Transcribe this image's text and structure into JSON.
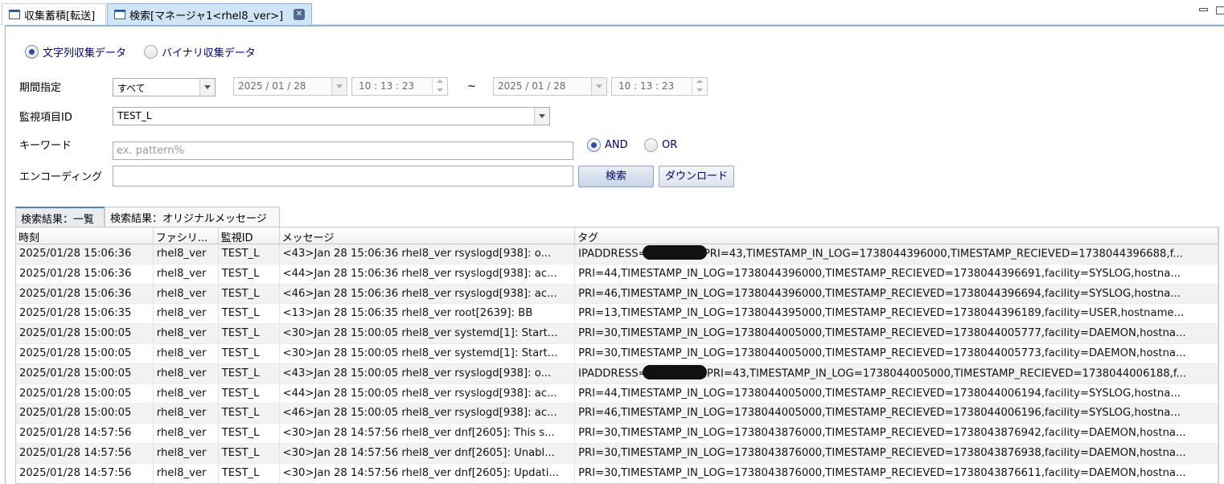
{
  "tabs": [
    {
      "label": "収集蓄積[転送]",
      "active": false
    },
    {
      "label": "検索[マネージャ1<rhel8_ver>]",
      "active": true,
      "close": "✕"
    }
  ],
  "form": {
    "data_type": {
      "string_label": "文字列収集データ",
      "binary_label": "バイナリ収集データ",
      "selected": "string"
    },
    "period": {
      "label": "期間指定",
      "mode": "すべて",
      "from_date": "2025 / 01 / 28",
      "from_time": "10 : 13 : 23",
      "separator": "~",
      "to_date": "2025 / 01 / 28",
      "to_time": "10 : 13 : 23"
    },
    "monitor_id": {
      "label": "監視項目ID",
      "value": "TEST_L"
    },
    "keyword": {
      "label": "キーワード",
      "placeholder": "ex. pattern%",
      "value": ""
    },
    "operator": {
      "and_label": "AND",
      "or_label": "OR",
      "selected": "AND"
    },
    "encoding": {
      "label": "エンコーディング",
      "value": ""
    },
    "search_button": "検索",
    "download_button": "ダウンロード"
  },
  "result_tabs": [
    "検索結果：一覧",
    "検索結果：オリジナルメッセージ"
  ],
  "table": {
    "columns": [
      "時刻",
      "ファシリ...",
      "監視ID",
      "メッセージ",
      "タグ"
    ],
    "rows": [
      {
        "time": "2025/01/28 15:06:36",
        "facility": "rhel8_ver",
        "monitor": "TEST_L",
        "message": "<43>Jan 28 15:06:36 rhel8_ver rsyslogd[938]: o...",
        "tag_prefix": "IPADDRESS=",
        "redacted": true,
        "tag": "PRI=43,TIMESTAMP_IN_LOG=1738044396000,TIMESTAMP_RECIEVED=1738044396688,f..."
      },
      {
        "time": "2025/01/28 15:06:36",
        "facility": "rhel8_ver",
        "monitor": "TEST_L",
        "message": "<44>Jan 28 15:06:36 rhel8_ver rsyslogd[938]: ac...",
        "tag_prefix": "",
        "redacted": false,
        "tag": "PRI=44,TIMESTAMP_IN_LOG=1738044396000,TIMESTAMP_RECIEVED=1738044396691,facility=SYSLOG,hostna..."
      },
      {
        "time": "2025/01/28 15:06:36",
        "facility": "rhel8_ver",
        "monitor": "TEST_L",
        "message": "<46>Jan 28 15:06:36 rhel8_ver rsyslogd[938]: ac...",
        "tag_prefix": "",
        "redacted": false,
        "tag": "PRI=46,TIMESTAMP_IN_LOG=1738044396000,TIMESTAMP_RECIEVED=1738044396694,facility=SYSLOG,hostna..."
      },
      {
        "time": "2025/01/28 15:06:35",
        "facility": "rhel8_ver",
        "monitor": "TEST_L",
        "message": "<13>Jan 28 15:06:35 rhel8_ver root[2639]: BB",
        "tag_prefix": "",
        "redacted": false,
        "tag": "PRI=13,TIMESTAMP_IN_LOG=1738044395000,TIMESTAMP_RECIEVED=1738044396189,facility=USER,hostname..."
      },
      {
        "time": "2025/01/28 15:00:05",
        "facility": "rhel8_ver",
        "monitor": "TEST_L",
        "message": "<30>Jan 28 15:00:05 rhel8_ver systemd[1]: Start...",
        "tag_prefix": "",
        "redacted": false,
        "tag": "PRI=30,TIMESTAMP_IN_LOG=1738044005000,TIMESTAMP_RECIEVED=1738044005777,facility=DAEMON,hostna..."
      },
      {
        "time": "2025/01/28 15:00:05",
        "facility": "rhel8_ver",
        "monitor": "TEST_L",
        "message": "<30>Jan 28 15:00:05 rhel8_ver systemd[1]: Start...",
        "tag_prefix": "",
        "redacted": false,
        "tag": "PRI=30,TIMESTAMP_IN_LOG=1738044005000,TIMESTAMP_RECIEVED=1738044005773,facility=DAEMON,hostna..."
      },
      {
        "time": "2025/01/28 15:00:05",
        "facility": "rhel8_ver",
        "monitor": "TEST_L",
        "message": "<43>Jan 28 15:00:05 rhel8_ver rsyslogd[938]: o...",
        "tag_prefix": "IPADDRESS=",
        "redacted": true,
        "tag": ",PRI=43,TIMESTAMP_IN_LOG=1738044005000,TIMESTAMP_RECIEVED=1738044006188,f..."
      },
      {
        "time": "2025/01/28 15:00:05",
        "facility": "rhel8_ver",
        "monitor": "TEST_L",
        "message": "<44>Jan 28 15:00:05 rhel8_ver rsyslogd[938]: ac...",
        "tag_prefix": "",
        "redacted": false,
        "tag": "PRI=44,TIMESTAMP_IN_LOG=1738044005000,TIMESTAMP_RECIEVED=1738044006194,facility=SYSLOG,hostna..."
      },
      {
        "time": "2025/01/28 15:00:05",
        "facility": "rhel8_ver",
        "monitor": "TEST_L",
        "message": "<46>Jan 28 15:00:05 rhel8_ver rsyslogd[938]: ac...",
        "tag_prefix": "",
        "redacted": false,
        "tag": "PRI=46,TIMESTAMP_IN_LOG=1738044005000,TIMESTAMP_RECIEVED=1738044006196,facility=SYSLOG,hostna..."
      },
      {
        "time": "2025/01/28 14:57:56",
        "facility": "rhel8_ver",
        "monitor": "TEST_L",
        "message": "<30>Jan 28 14:57:56 rhel8_ver dnf[2605]: This s...",
        "tag_prefix": "",
        "redacted": false,
        "tag": "PRI=30,TIMESTAMP_IN_LOG=1738043876000,TIMESTAMP_RECIEVED=1738043876942,facility=DAEMON,hostna..."
      },
      {
        "time": "2025/01/28 14:57:56",
        "facility": "rhel8_ver",
        "monitor": "TEST_L",
        "message": "<30>Jan 28 14:57:56 rhel8_ver dnf[2605]: Unabl...",
        "tag_prefix": "",
        "redacted": false,
        "tag": "PRI=30,TIMESTAMP_IN_LOG=1738043876000,TIMESTAMP_RECIEVED=1738043876938,facility=DAEMON,hostna..."
      },
      {
        "time": "2025/01/28 14:57:56",
        "facility": "rhel8_ver",
        "monitor": "TEST_L",
        "message": "<30>Jan 28 14:57:56 rhel8_ver dnf[2605]: Updati...",
        "tag_prefix": "",
        "redacted": false,
        "tag": "PRI=30,TIMESTAMP_IN_LOG=1738043876000,TIMESTAMP_RECIEVED=1738043876611,facility=DAEMON,hostna..."
      }
    ]
  }
}
